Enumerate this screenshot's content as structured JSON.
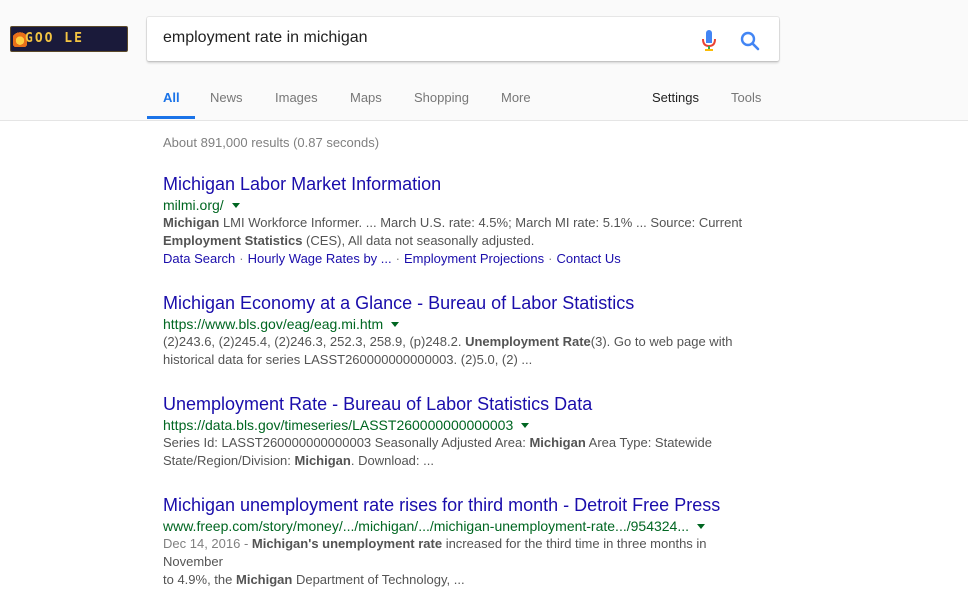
{
  "header": {
    "logo_text": "GOO LE",
    "search_query": "employment rate in michigan"
  },
  "tabs": {
    "all": "All",
    "news": "News",
    "images": "Images",
    "maps": "Maps",
    "shopping": "Shopping",
    "more": "More",
    "settings": "Settings",
    "tools": "Tools"
  },
  "stats": "About 891,000 results (0.87 seconds)",
  "results": [
    {
      "title": "Michigan Labor Market Information",
      "url": "milmi.org/",
      "s1_b1": "Michigan",
      "s1_t1": " LMI Workforce Informer. ... March U.S. rate: 4.5%; March MI rate: 5.1% ... Source: Current",
      "s2_b1": "Employment Statistics",
      "s2_t1": " (CES), All data not seasonally adjusted.",
      "sitelinks": [
        "Data Search",
        "Hourly Wage Rates by ...",
        "Employment Projections",
        "Contact Us"
      ],
      "sitelink_sep": "·"
    },
    {
      "title": "Michigan Economy at a Glance - Bureau of Labor Statistics",
      "url": "https://www.bls.gov/eag/eag.mi.htm",
      "s1_t1": "(2)243.6, (2)245.4, (2)246.3, 252.3, 258.9, (p)248.2. ",
      "s1_b1": "Unemployment Rate",
      "s1_t2": "(3). Go to web page with",
      "s2_t1": "historical data for series LASST260000000000003. (2)5.0, (2) ..."
    },
    {
      "title": "Unemployment Rate - Bureau of Labor Statistics Data",
      "url": "https://data.bls.gov/timeseries/LASST260000000000003",
      "s1_t1": "Series Id: LASST260000000000003 Seasonally Adjusted Area: ",
      "s1_b1": "Michigan",
      "s1_t2": " Area Type: Statewide",
      "s2_t1": "State/Region/Division: ",
      "s2_b1": "Michigan",
      "s2_t2": ". Download: ..."
    },
    {
      "title": "Michigan unemployment rate rises for third month - Detroit Free Press",
      "url": "www.freep.com/story/money/.../michigan/.../michigan-unemployment-rate.../954324...",
      "date": "Dec 14, 2016 - ",
      "s1_b1": "Michigan's unemployment rate",
      "s1_t1": " increased for the third time in three months in November",
      "s2_t1": "to 4.9%, the ",
      "s2_b1": "Michigan",
      "s2_t2": " Department of Technology, ..."
    }
  ],
  "icons": {
    "mic": "microphone-icon",
    "search": "search-icon",
    "caret": "dropdown-caret-icon"
  },
  "colors": {
    "link": "#1a0dab",
    "url": "#006621",
    "snippet": "#545454",
    "active_tab": "#1a73e8"
  }
}
